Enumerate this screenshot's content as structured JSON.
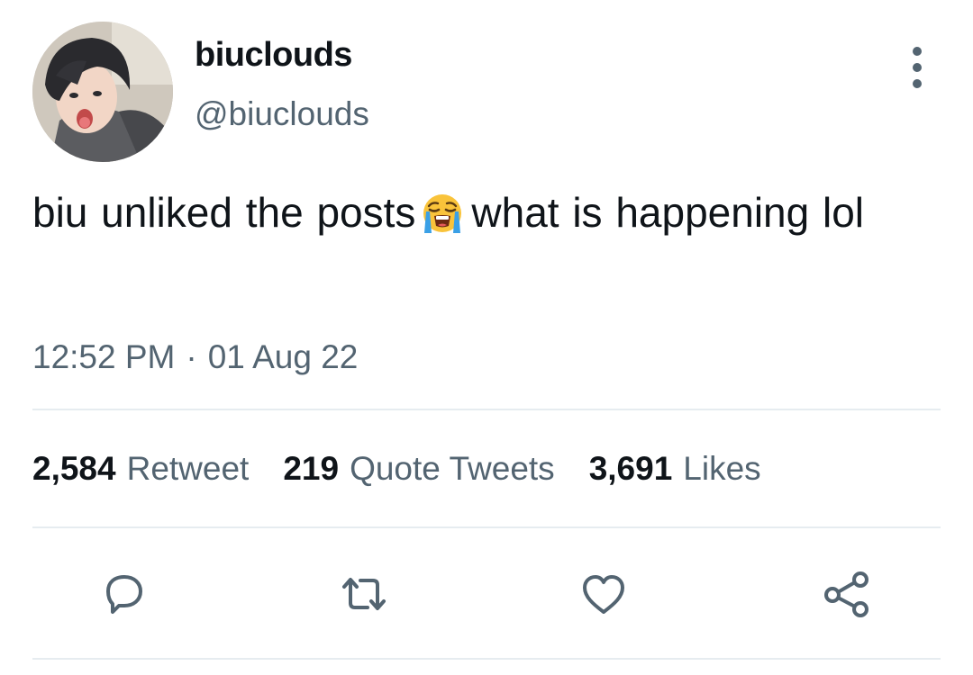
{
  "author": {
    "display_name": "biuclouds",
    "handle": "@biuclouds"
  },
  "tweet": {
    "text_before_emoji": "biu unliked the posts",
    "emoji": "loudly-crying-face",
    "text_after_emoji": "what is happening lol",
    "time": "12:52 PM",
    "separator": "·",
    "date": "01 Aug 22"
  },
  "stats": {
    "retweets_count": "2,584",
    "retweets_label": "Retweet",
    "quotes_count": "219",
    "quotes_label": "Quote Tweets",
    "likes_count": "3,691",
    "likes_label": "Likes"
  },
  "icons": {
    "reply": "reply-icon",
    "retweet": "retweet-icon",
    "like": "heart-icon",
    "share": "share-icon",
    "more": "more-options-icon"
  },
  "colors": {
    "text_primary": "#0f1419",
    "text_secondary": "#536471",
    "divider": "#e6ecf0",
    "emoji_face": "#f9c33a",
    "emoji_tears": "#3aa0e6"
  }
}
